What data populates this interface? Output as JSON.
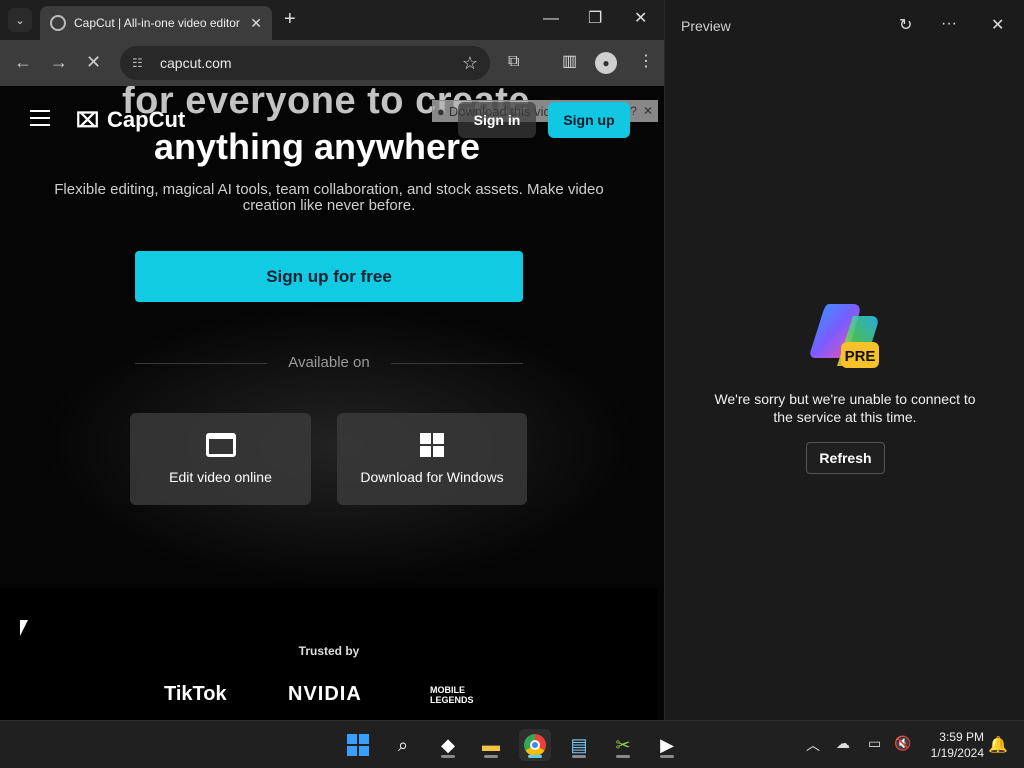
{
  "browser": {
    "tab_title": "CapCut | All-in-one video editor",
    "tab_close": "✕",
    "new_tab": "+",
    "url": "capcut.com",
    "controls": {
      "minimize": "—",
      "restore": "❐",
      "close": "✕"
    },
    "icons": [
      "tab-search-icon",
      "back-icon",
      "forward-icon",
      "stop-icon",
      "site-info-icon",
      "star-icon",
      "extensions-icon",
      "side-panel-icon",
      "profile-icon",
      "menu-icon"
    ]
  },
  "capcut": {
    "hero_line1": "for everyone to create",
    "hero_line2": "anything anywhere",
    "logo_text": "CapCut",
    "sign_in": "Sign in",
    "sign_up": "Sign up",
    "download_overlay": "Download this video",
    "download_overlay_help": "?",
    "download_overlay_close": "✕",
    "tagline": "Flexible editing, magical AI tools, team collaboration, and stock assets. Make video creation like never before.",
    "cta": "Sign up for free",
    "available_on": "Available on",
    "platforms": [
      {
        "label": "Edit video online",
        "icon": "browser-window-icon"
      },
      {
        "label": "Download for Windows",
        "icon": "windows-logo-icon"
      }
    ],
    "trusted_by": "Trusted by",
    "brands": [
      "TikTok",
      "NVIDIA",
      "MOBILE LEGENDS"
    ]
  },
  "preview": {
    "title": "Preview",
    "refresh_icon": "↻",
    "more_icon": "···",
    "close_icon": "✕",
    "badge": "PRE",
    "message": "We're sorry but we're unable to connect to the service at this time.",
    "refresh_button": "Refresh"
  },
  "taskbar": {
    "apps": [
      "windows-start-icon",
      "search-icon",
      "copilot-icon",
      "file-explorer-icon",
      "chrome-icon",
      "notepad-icon",
      "snipping-icon",
      "media-player-icon"
    ],
    "time": "3:59 PM",
    "date": "1/19/2024",
    "tray_icons": [
      "chevron-up-icon",
      "onedrive-icon",
      "network-icon",
      "volume-muted-icon",
      "notification-bell-icon"
    ]
  },
  "colors": {
    "accent_cyan": "#10cbe2",
    "taskbar_active": "#60cdff",
    "bell_blue": "#2f93ff"
  }
}
